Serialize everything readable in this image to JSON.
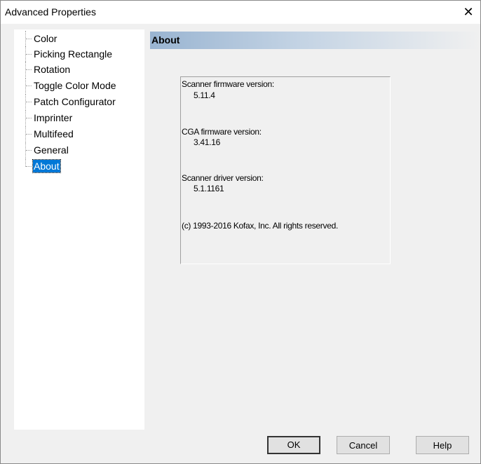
{
  "window": {
    "title": "Advanced Properties",
    "close_glyph": "✕"
  },
  "tree": {
    "items": [
      {
        "label": "Color"
      },
      {
        "label": "Picking Rectangle"
      },
      {
        "label": "Rotation"
      },
      {
        "label": "Toggle Color Mode"
      },
      {
        "label": "Patch Configurator"
      },
      {
        "label": "Imprinter"
      },
      {
        "label": "Multifeed"
      },
      {
        "label": "General"
      },
      {
        "label": "About"
      }
    ],
    "selected": "About"
  },
  "panel": {
    "title": "About",
    "scanner_firmware_label": "Scanner firmware version:",
    "scanner_firmware_value": "5.11.4",
    "cga_firmware_label": "CGA firmware version:",
    "cga_firmware_value": "3.41.16",
    "scanner_driver_label": "Scanner driver version:",
    "scanner_driver_value": "5.1.1161",
    "copyright": "(c) 1993-2016 Kofax, Inc. All rights reserved."
  },
  "buttons": {
    "ok": "OK",
    "cancel": "Cancel",
    "help": "Help"
  },
  "colors": {
    "selection": "#0078d7",
    "header_gradient_start": "#99b4d1",
    "dialog_bg": "#f0f0f0"
  }
}
